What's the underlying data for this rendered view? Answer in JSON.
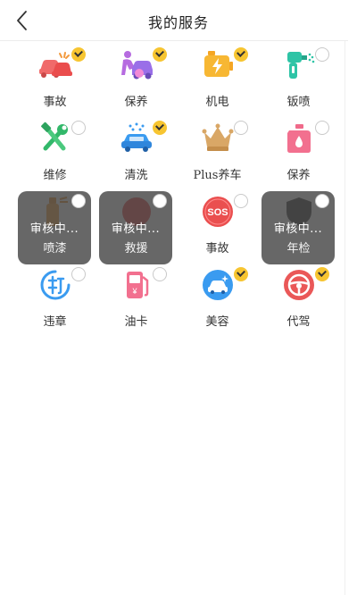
{
  "header": {
    "title": "我的服务"
  },
  "review_text": "审核中...",
  "colors": {
    "check": "#f7c531",
    "overlay": "#464646",
    "divider": "#ececec"
  },
  "services": [
    {
      "label": "事故",
      "icon": "car-crash-icon",
      "selected": true,
      "reviewing": false
    },
    {
      "label": "保养",
      "icon": "car-maintenance-icon",
      "selected": true,
      "reviewing": false
    },
    {
      "label": "机电",
      "icon": "battery-icon",
      "selected": true,
      "reviewing": false
    },
    {
      "label": "钣喷",
      "icon": "spray-gun-icon",
      "selected": false,
      "reviewing": false
    },
    {
      "label": "维修",
      "icon": "tools-icon",
      "selected": false,
      "reviewing": false
    },
    {
      "label": "清洗",
      "icon": "car-wash-icon",
      "selected": true,
      "reviewing": false
    },
    {
      "label": "Plus养车",
      "icon": "crown-icon",
      "selected": false,
      "reviewing": false
    },
    {
      "label": "保养",
      "icon": "oil-can-icon",
      "selected": false,
      "reviewing": false
    },
    {
      "label": "喷漆",
      "icon": "paint-spray-icon",
      "selected": false,
      "reviewing": true
    },
    {
      "label": "救援",
      "icon": "sos-icon",
      "selected": false,
      "reviewing": true
    },
    {
      "label": "事故",
      "icon": "sos-icon",
      "selected": false,
      "reviewing": false
    },
    {
      "label": "年检",
      "icon": "inspection-shield-icon",
      "selected": false,
      "reviewing": true
    },
    {
      "label": "违章",
      "icon": "violation-icon",
      "selected": false,
      "reviewing": false
    },
    {
      "label": "油卡",
      "icon": "fuel-card-icon",
      "selected": false,
      "reviewing": false
    },
    {
      "label": "美容",
      "icon": "car-beauty-icon",
      "selected": true,
      "reviewing": false
    },
    {
      "label": "代驾",
      "icon": "steering-wheel-icon",
      "selected": true,
      "reviewing": false
    }
  ]
}
